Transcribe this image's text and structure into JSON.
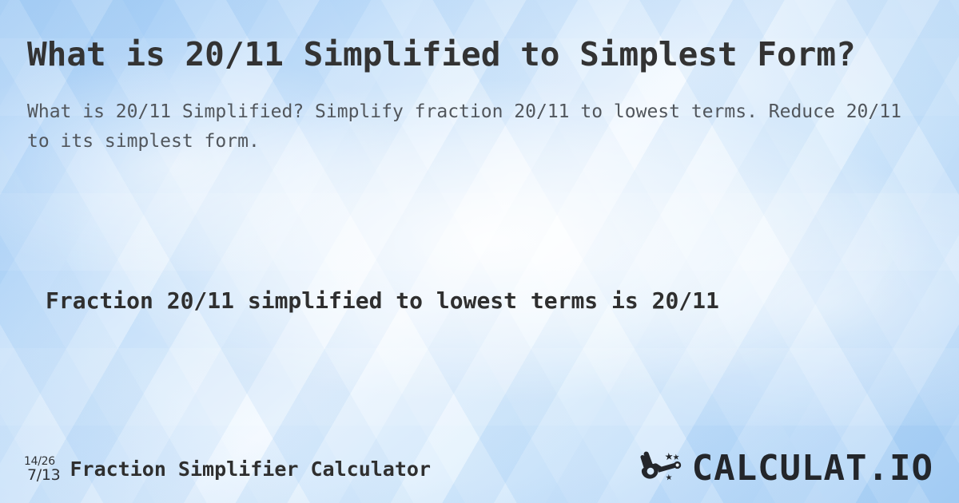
{
  "page": {
    "title": "What is 20/11 Simplified to Simplest Form?",
    "subtitle": "What is 20/11 Simplified? Simplify fraction 20/11 to lowest terms. Reduce 20/11 to its simplest form.",
    "answer": "Fraction 20/11 simplified to lowest terms is 20/11"
  },
  "footer": {
    "icon": {
      "name": "fraction-reduce-icon",
      "numerator_fraction": "14/26",
      "denominator_fraction": "7/13"
    },
    "title": "Fraction Simplifier Calculator",
    "brand": {
      "mark": "magic-wand-hand-icon",
      "text": "CALCULAT.IO"
    }
  },
  "colors": {
    "title_text": "#333333",
    "subtitle_text": "#51565c",
    "answer_text": "#2f2f2f",
    "brand_text": "#23262b",
    "background_blue_dark": "#9fcaf4",
    "background_blue_light": "#eef6fe"
  }
}
